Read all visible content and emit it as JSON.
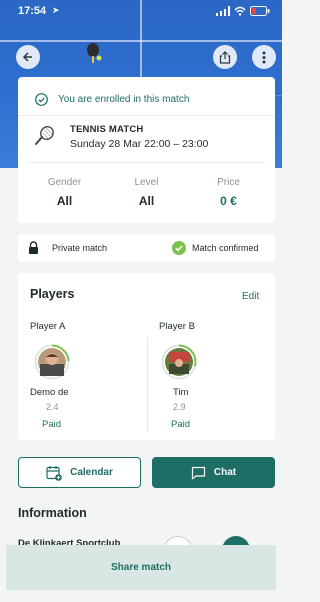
{
  "status_bar": {
    "time": "17:54"
  },
  "enrollment": {
    "message": "You are enrolled in this match",
    "match_type": "TENNIS MATCH",
    "datetime": "Sunday 28 Mar 22:00 – 23:00"
  },
  "filters": [
    {
      "label": "Gender",
      "value": "All"
    },
    {
      "label": "Level",
      "value": "All"
    },
    {
      "label": "Price",
      "value": "0 €"
    }
  ],
  "privacy": {
    "label": "Private match",
    "status": "Match confirmed"
  },
  "players": {
    "title": "Players",
    "edit_label": "Edit",
    "list": [
      {
        "team_label": "Player A",
        "name": "Demo de",
        "level": "2.4",
        "payment": "Paid",
        "level_ring_fraction": 0.24
      },
      {
        "team_label": "Player B",
        "name": "Tim",
        "level": "2.9",
        "payment": "Paid",
        "level_ring_fraction": 0.29
      }
    ]
  },
  "actions": {
    "calendar_label": "Calendar",
    "chat_label": "Chat"
  },
  "information": {
    "title": "Information",
    "club_name": "De Klinkaert Sportclub"
  },
  "footer": {
    "share_label": "Share match"
  },
  "colors": {
    "accent": "#1d6e64",
    "confirm_green": "#7bc24b",
    "hero_blue": "#2f6fd0"
  }
}
